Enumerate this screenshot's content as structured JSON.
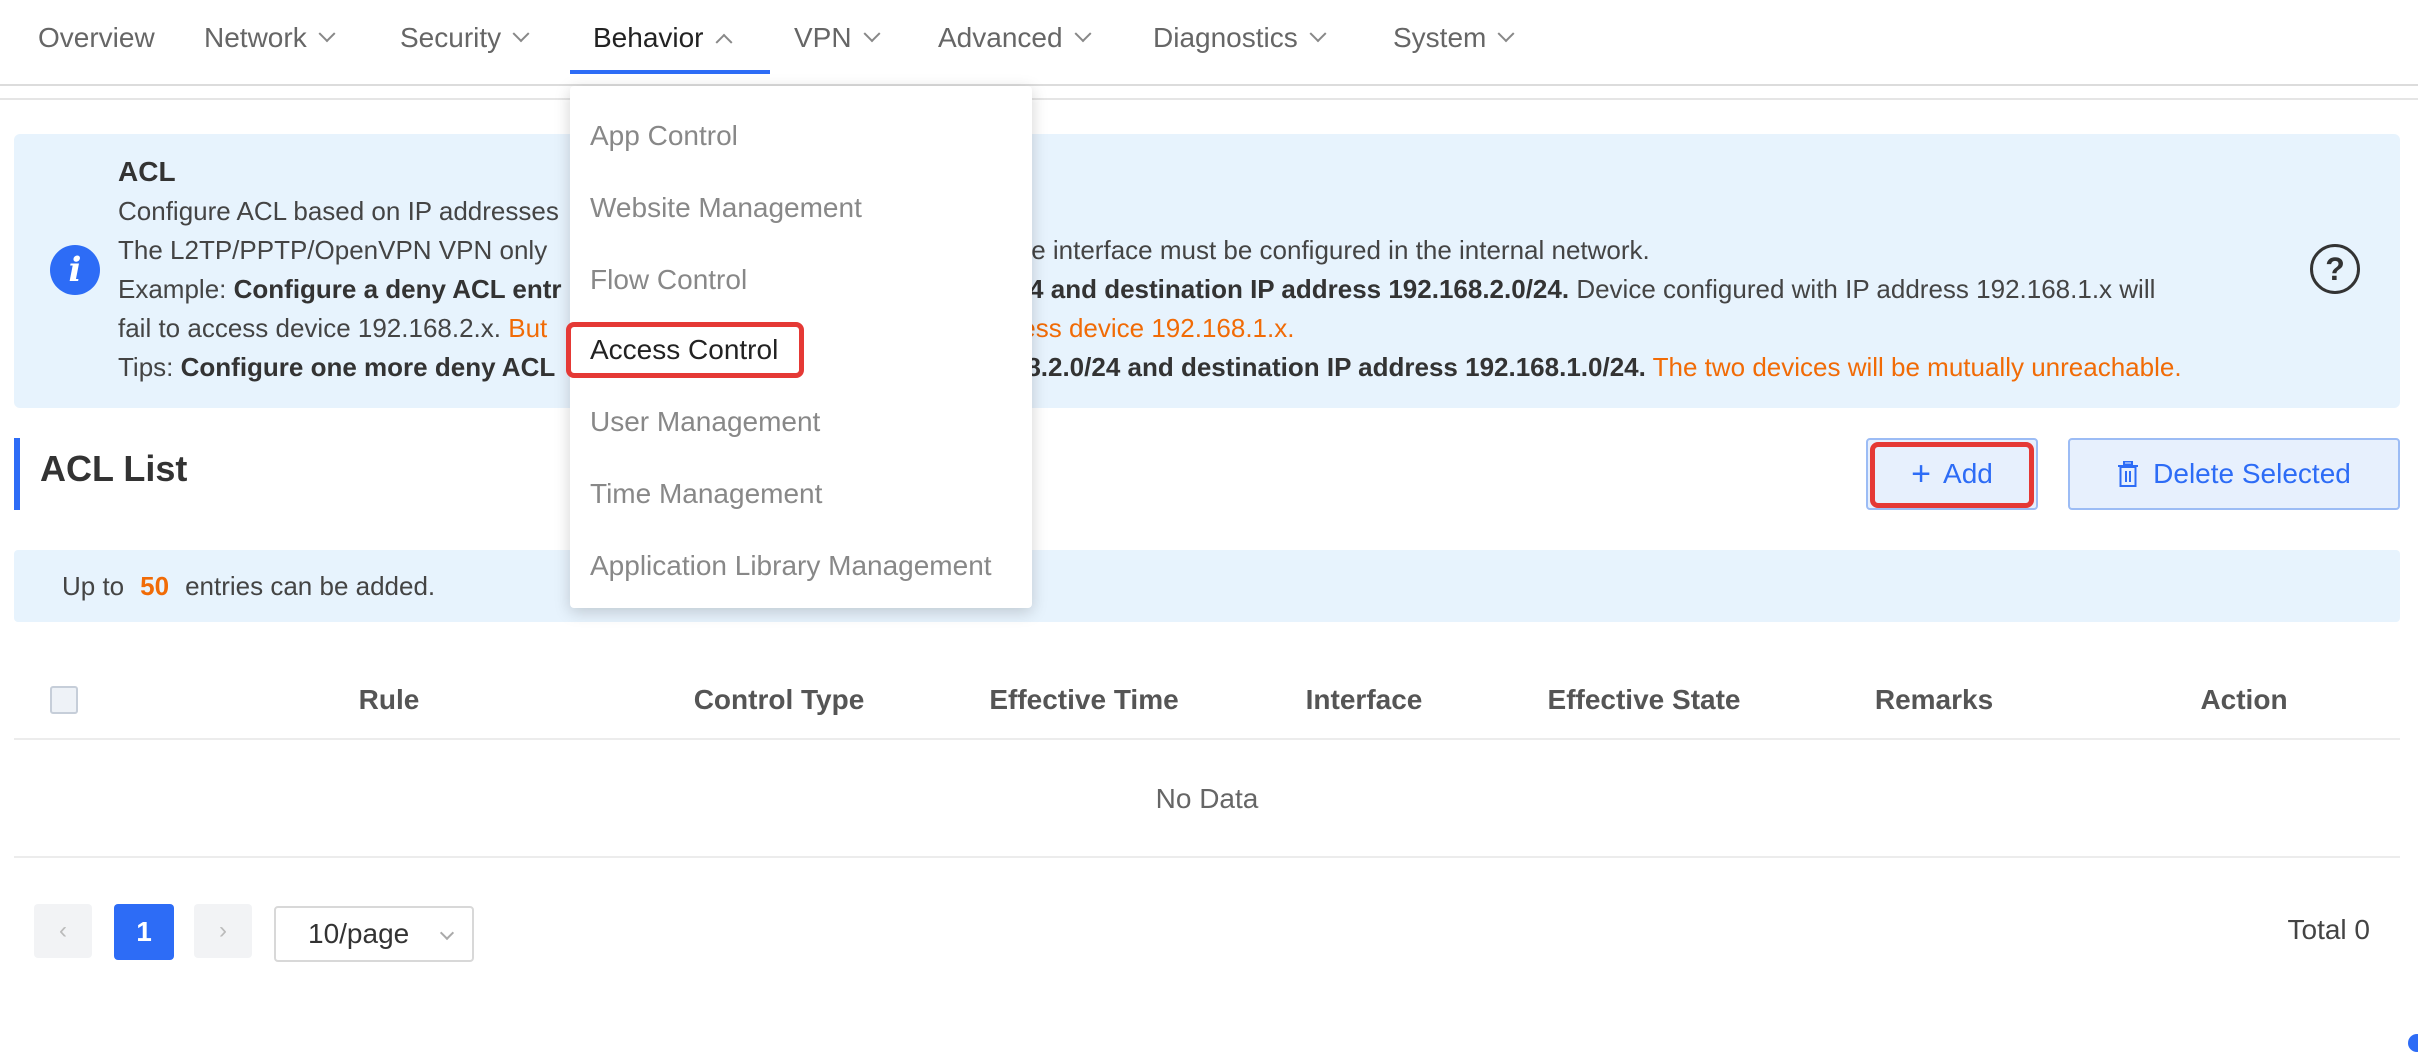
{
  "nav": {
    "items": [
      {
        "label": "Overview",
        "has_menu": false
      },
      {
        "label": "Network",
        "has_menu": true
      },
      {
        "label": "Security",
        "has_menu": true
      },
      {
        "label": "Behavior",
        "has_menu": true,
        "active": true
      },
      {
        "label": "VPN",
        "has_menu": true
      },
      {
        "label": "Advanced",
        "has_menu": true
      },
      {
        "label": "Diagnostics",
        "has_menu": true
      },
      {
        "label": "System",
        "has_menu": true
      }
    ],
    "accent_color": "#2d6cf6"
  },
  "dropdown": {
    "items": [
      "App Control",
      "Website Management",
      "Flow Control",
      "Access Control",
      "User Management",
      "Time Management",
      "Application Library Management"
    ],
    "selected": "Access Control"
  },
  "info": {
    "title": "ACL",
    "line1": "Configure ACL based on IP addresses",
    "line2a": "The L2TP/PPTP/OpenVPN VPN only",
    "line2b": "tive interface must be configured in the internal network.",
    "line3_prefix": "Example:",
    "line3a_bold": "Configure a deny ACL entr",
    "line3b_bold": "8.1.0/24 and destination IP address 192.168.2.0/24.",
    "line3c": "Device configured with IP address 192.168.1.x will",
    "line4a": "fail to access device 192.168.2.x.",
    "line4b_orange": "But",
    "line4c_orange": "ccess device 192.168.1.x.",
    "line5_prefix": "Tips:",
    "line5a_bold": "Configure one more deny ACL",
    "line5b_bold": "92.168.2.0/24 and destination IP address 192.168.1.0/24.",
    "line5c_orange": "The two devices will be mutually unreachable.",
    "info_icon": "info-icon",
    "help_icon": "help-circle-icon",
    "help_glyph": "?"
  },
  "acl_list": {
    "title": "ACL List",
    "add_label": "Add",
    "add_glyph": "+",
    "delete_label": "Delete Selected"
  },
  "notice": {
    "prefix": "Up to",
    "count": "50",
    "suffix": "entries can be added."
  },
  "table": {
    "columns": [
      "Rule",
      "Control Type",
      "Effective Time",
      "Interface",
      "Effective State",
      "Remarks",
      "Action"
    ],
    "empty_text": "No Data"
  },
  "pagination": {
    "current_page": "1",
    "prev_glyph": "‹",
    "next_glyph": "›",
    "page_size": "10/page",
    "total": "Total 0"
  },
  "colors": {
    "accent": "#2d6cf6",
    "highlight": "#e53935",
    "warning_text": "#f16b06",
    "info_bg": "#e7f3fd"
  }
}
